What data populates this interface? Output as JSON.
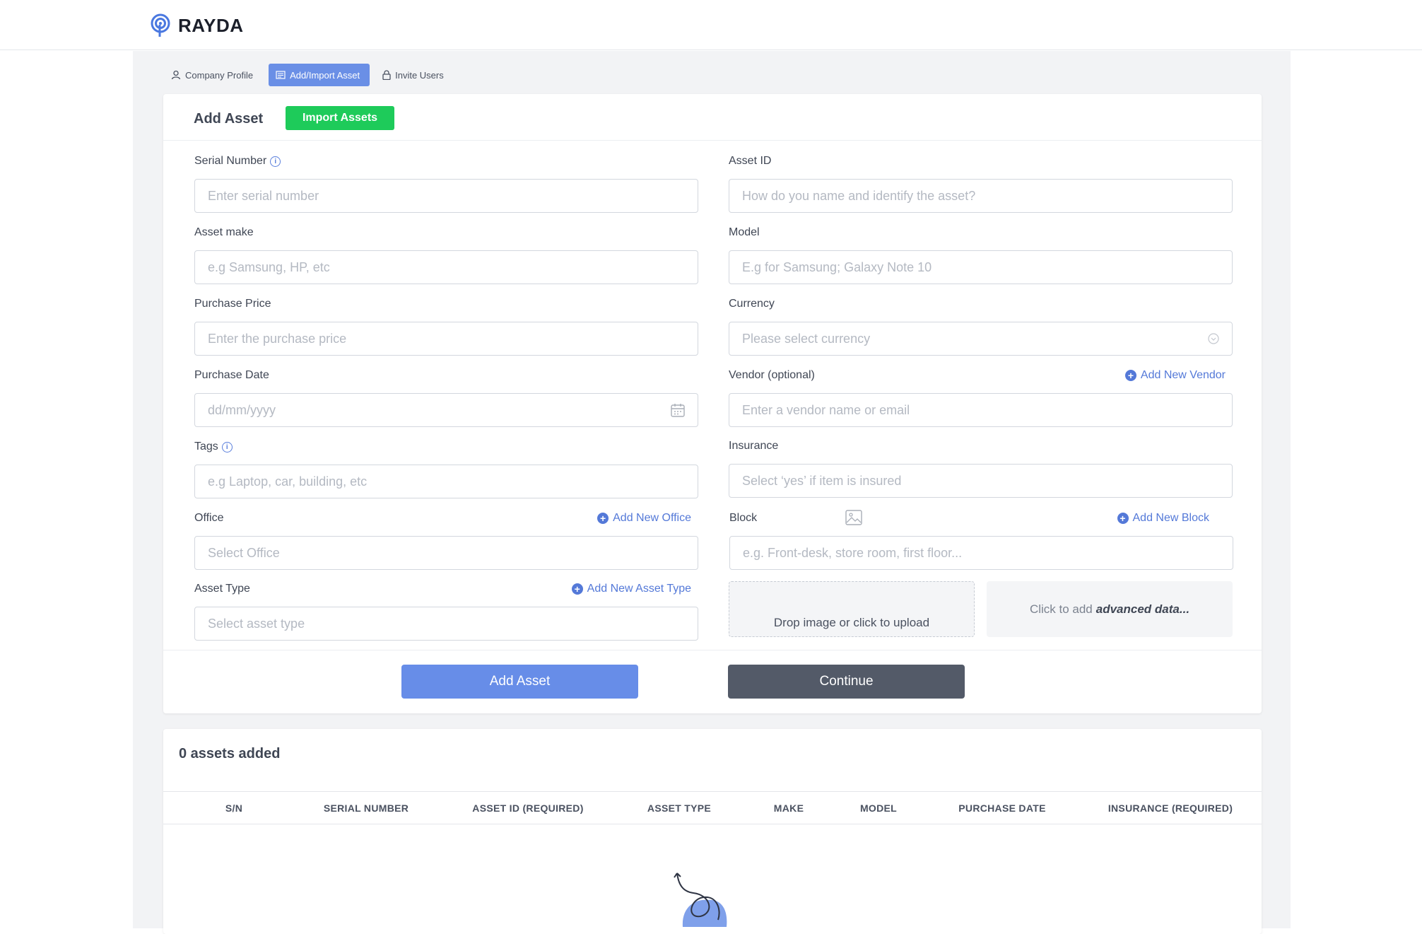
{
  "brand": {
    "name": "RAYDA"
  },
  "tabs": [
    {
      "label": "Company Profile"
    },
    {
      "label": "Add/Import Asset"
    },
    {
      "label": "Invite Users"
    }
  ],
  "form": {
    "title": "Add Asset",
    "import_label": "Import Assets",
    "serial": {
      "label": "Serial Number",
      "placeholder": "Enter serial number"
    },
    "asset_id": {
      "label": "Asset ID",
      "placeholder": "How do you name and identify the asset?"
    },
    "make": {
      "label": "Asset make",
      "placeholder": "e.g Samsung, HP, etc"
    },
    "model": {
      "label": "Model",
      "placeholder": "E.g for Samsung; Galaxy Note 10"
    },
    "price": {
      "label": "Purchase Price",
      "placeholder": "Enter the purchase price"
    },
    "currency": {
      "label": "Currency",
      "placeholder": "Please select currency"
    },
    "date": {
      "label": "Purchase Date",
      "placeholder": "dd/mm/yyyy"
    },
    "vendor": {
      "label": "Vendor (optional)",
      "placeholder": "Enter a vendor name or email",
      "add_label": "Add New Vendor"
    },
    "tags": {
      "label": "Tags",
      "placeholder": "e.g Laptop, car, building, etc"
    },
    "insurance": {
      "label": "Insurance",
      "placeholder": "Select ‘yes’ if item is insured"
    },
    "office": {
      "label": "Office",
      "placeholder": "Select Office",
      "add_label": "Add New Office"
    },
    "block": {
      "label": "Block",
      "placeholder": "e.g. Front-desk, store room, first floor...",
      "add_label": "Add New Block"
    },
    "asset_type": {
      "label": "Asset Type",
      "placeholder": "Select asset type",
      "add_label": "Add New Asset Type"
    },
    "upload_label": "Drop image or click to upload",
    "advanced_prefix": "Click to add",
    "advanced_bold": "advanced data...",
    "add_button": "Add Asset",
    "continue_button": "Continue"
  },
  "table": {
    "title": "0 assets added",
    "columns": [
      "S/N",
      "SERIAL NUMBER",
      "ASSET ID (REQUIRED)",
      "ASSET TYPE",
      "MAKE",
      "MODEL",
      "PURCHASE DATE",
      "INSURANCE (REQUIRED)"
    ]
  },
  "colors": {
    "primary": "#678de8",
    "success": "#1ecb5a",
    "dark": "#535a68",
    "link": "#5479d8"
  }
}
